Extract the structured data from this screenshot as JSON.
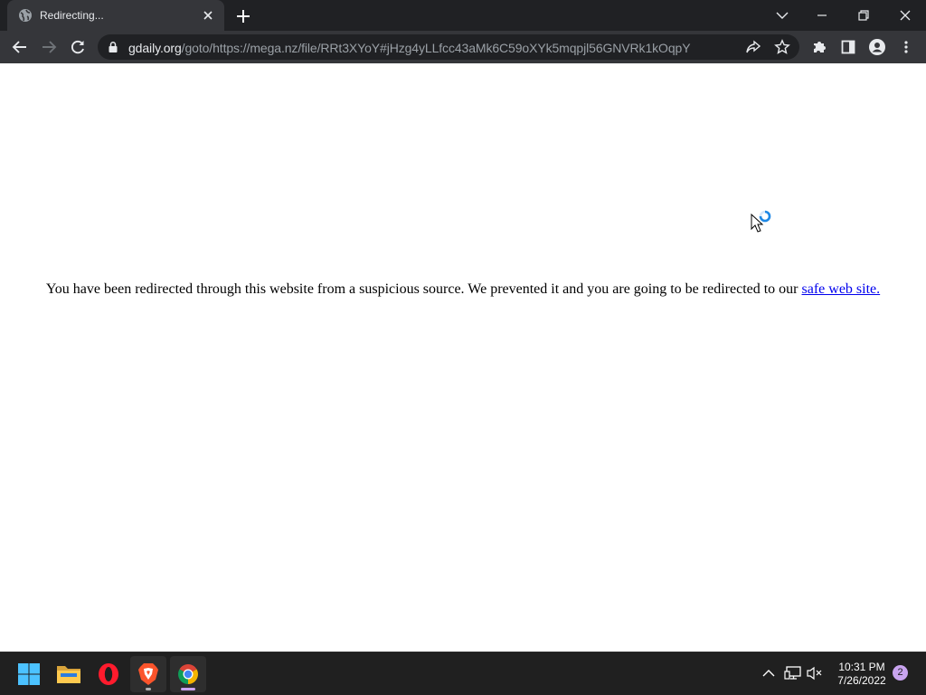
{
  "browser": {
    "tab": {
      "title": "Redirecting...",
      "favicon": "globe-icon"
    },
    "url": {
      "host": "gdaily.org",
      "rest": "/goto/https://mega.nz/file/RRt3XYoY#jHzg4yLLfcc43aMk6C59oXYk5mqpjl56GNVRk1kOqpY"
    },
    "colors": {
      "tabstrip": "#202124",
      "toolbar": "#35363a",
      "omnibox": "#202124",
      "accent": "#8ab4f8"
    }
  },
  "page": {
    "message": "You have been redirected through this website from a suspicious source. We prevented it and you are going to be redirected to our",
    "link_text": "safe web site."
  },
  "taskbar": {
    "apps": [
      {
        "name": "Start",
        "icon": "windows-logo-icon"
      },
      {
        "name": "File Explorer",
        "icon": "folder-icon"
      },
      {
        "name": "Opera",
        "icon": "opera-icon"
      },
      {
        "name": "Brave",
        "icon": "brave-icon"
      },
      {
        "name": "Google Chrome",
        "icon": "chrome-icon"
      }
    ],
    "time": "10:31 PM",
    "date": "7/26/2022",
    "notifications": "2"
  }
}
